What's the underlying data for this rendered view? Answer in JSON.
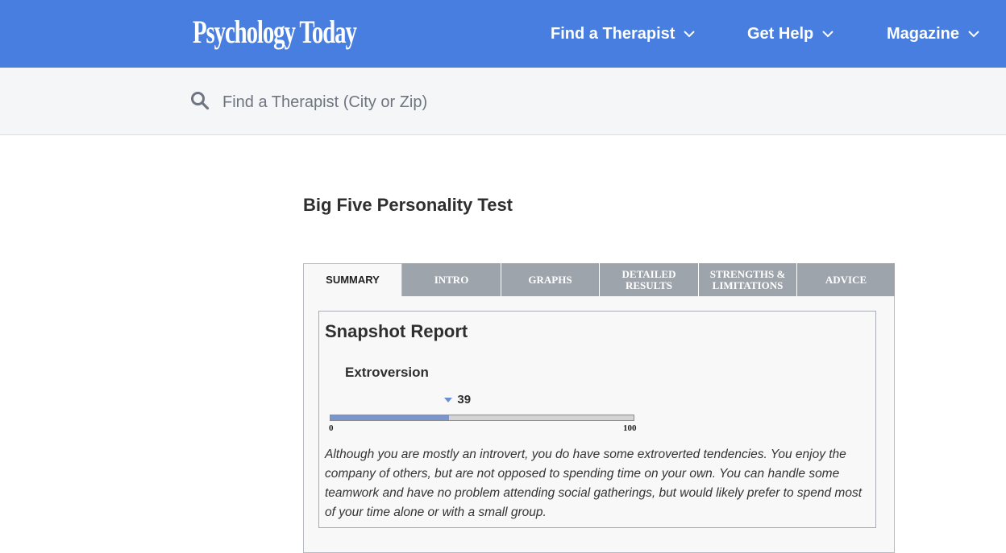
{
  "header": {
    "logo_text": "Psychology Today",
    "nav": [
      {
        "label": "Find a Therapist"
      },
      {
        "label": "Get Help"
      },
      {
        "label": "Magazine"
      }
    ]
  },
  "search": {
    "placeholder": "Find a Therapist (City or Zip)"
  },
  "main": {
    "title": "Big Five Personality Test",
    "tabs": [
      {
        "label": "SUMMARY",
        "active": true
      },
      {
        "label": "INTRO"
      },
      {
        "label": "GRAPHS"
      },
      {
        "label": "DETAILED RESULTS"
      },
      {
        "label": "STRENGTHS & LIMITATIONS"
      },
      {
        "label": "ADVICE"
      }
    ],
    "report": {
      "title": "Snapshot Report",
      "trait": "Extroversion",
      "score": 39,
      "score_label": "39",
      "scale_min": "0",
      "scale_max": "100",
      "description": "Although you are mostly an introvert, you do have some extroverted tendencies. You enjoy the company of others, but are not opposed to spending time on your own. You can handle some teamwork and have no problem attending social gatherings, but would likely prefer to spend most of your time alone or with a small group."
    }
  },
  "colors": {
    "header_bg": "#477ee0",
    "tab_bg": "#9ea4ab",
    "bar_fill": "#7b96cc"
  }
}
